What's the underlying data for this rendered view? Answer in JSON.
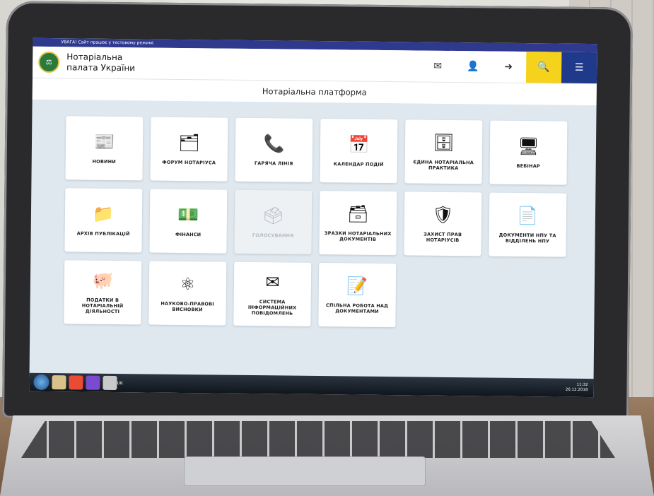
{
  "notice": "УВАГА! Сайт працює у тестовому режимі.",
  "brand": {
    "line1": "Нотаріальна",
    "line2": "палата України"
  },
  "header_icons": [
    "mail-icon",
    "user-icon",
    "logout-icon",
    "search-icon",
    "menu-icon"
  ],
  "subtitle": "Нотаріальна платформа",
  "tiles": [
    [
      {
        "label": "НОВИНИ",
        "icon": "newspaper-icon",
        "glyph": "📰"
      },
      {
        "label": "ФОРУМ НОТАРІУСА",
        "icon": "forum-icon",
        "glyph": "🗂"
      },
      {
        "label": "ГАРЯЧА ЛІНІЯ",
        "icon": "phone-icon",
        "glyph": "📞"
      },
      {
        "label": "КАЛЕНДАР ПОДІЙ",
        "icon": "calendar-icon",
        "glyph": "📅"
      },
      {
        "label": "ЄДИНА НОТАРІАЛЬНА ПРАКТИКА",
        "icon": "database-icon",
        "glyph": "🗄"
      },
      {
        "label": "ВЕБІНАР",
        "icon": "webinar-icon",
        "glyph": "🖥"
      }
    ],
    [
      {
        "label": "АРХІВ ПУБЛІКАЦІЙ",
        "icon": "folder-icon",
        "glyph": "📁"
      },
      {
        "label": "ФІНАНСИ",
        "icon": "money-icon",
        "glyph": "💵"
      },
      {
        "label": "ГОЛОСУВАННЯ",
        "icon": "ballot-icon",
        "glyph": "🗳",
        "disabled": true
      },
      {
        "label": "ЗРАЗКИ НОТАРІАЛЬНИХ ДОКУМЕНТІВ",
        "icon": "inbox-icon",
        "glyph": "🗃"
      },
      {
        "label": "ЗАХИСТ ПРАВ НОТАРІУСІВ",
        "icon": "shield-icon",
        "glyph": "🛡"
      },
      {
        "label": "ДОКУМЕНТИ НПУ ТА ВІДДІЛЕНЬ НПУ",
        "icon": "document-icon",
        "glyph": "📄"
      }
    ],
    [
      {
        "label": "ПОДАТКИ В НОТАРІАЛЬНІЙ ДІЯЛЬНОСТІ",
        "icon": "piggy-bank-icon",
        "glyph": "🐖"
      },
      {
        "label": "НАУКОВО-ПРАВОВІ ВИСНОВКИ",
        "icon": "atom-icon",
        "glyph": "⚛"
      },
      {
        "label": "СИСТЕМА ІНФОРМАЦІЙНИХ ПОВІДОМЛЕНЬ",
        "icon": "envelope-info-icon",
        "glyph": "✉"
      },
      {
        "label": "СПІЛЬНА РОБОТА НАД ДОКУМЕНТАМИ",
        "icon": "edit-document-icon",
        "glyph": "📝"
      }
    ]
  ],
  "taskbar": {
    "lang": "UK",
    "time": "11:32",
    "date": "26.12.2018"
  },
  "colors": {
    "accent_yellow": "#f5d21b",
    "accent_blue": "#1f3a8a",
    "notice_bar": "#2f3a8f"
  }
}
